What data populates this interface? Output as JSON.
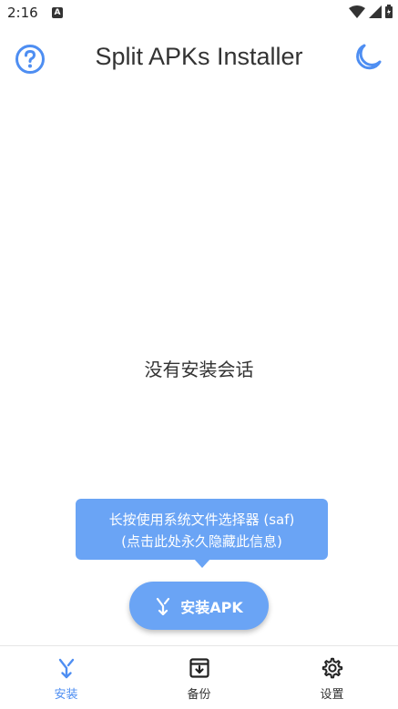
{
  "status_bar": {
    "time": "2:16",
    "notification_icon": "A"
  },
  "app_bar": {
    "title": "Split APKs Installer",
    "help_icon": "help-circle-icon",
    "theme_icon": "moon-icon"
  },
  "main": {
    "empty_message": "没有安装会话"
  },
  "tooltip": {
    "line1": "长按使用系统文件选择器 (saf)",
    "line2": "(点击此处永久隐藏此信息)"
  },
  "fab": {
    "label": "安装APK",
    "icon": "split-arrow-icon"
  },
  "bottom_nav": {
    "items": [
      {
        "label": "安装",
        "icon": "split-arrow-icon",
        "active": true
      },
      {
        "label": "备份",
        "icon": "archive-icon",
        "active": false
      },
      {
        "label": "设置",
        "icon": "gear-icon",
        "active": false
      }
    ]
  },
  "colors": {
    "accent": "#4e8ef2",
    "tooltip_bg": "#6aa4f5",
    "text": "#333333"
  }
}
